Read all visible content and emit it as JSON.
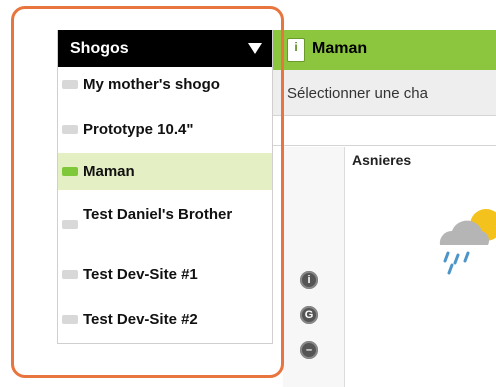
{
  "sidebar": {
    "title": "Shogos",
    "items": [
      {
        "label": "My mother's shogo",
        "active": false
      },
      {
        "label": "Prototype 10.4\"",
        "active": false
      },
      {
        "label": "Maman",
        "active": true
      },
      {
        "label": "Test Daniel's Brother",
        "active": false
      },
      {
        "label": "Test Dev-Site #1",
        "active": false
      },
      {
        "label": "Test Dev-Site #2",
        "active": false
      }
    ]
  },
  "main": {
    "title": "Maman",
    "subtitle": "Sélectionner une cha",
    "location": "Asnieres",
    "controls": [
      {
        "icon": "info-icon",
        "glyph": "i"
      },
      {
        "icon": "refresh-icon",
        "glyph": "G"
      },
      {
        "icon": "remove-icon",
        "glyph": "–"
      }
    ]
  },
  "colors": {
    "accent_green": "#8cc63e",
    "active_row": "#e4f0c4",
    "highlight_frame": "#e8753e"
  }
}
